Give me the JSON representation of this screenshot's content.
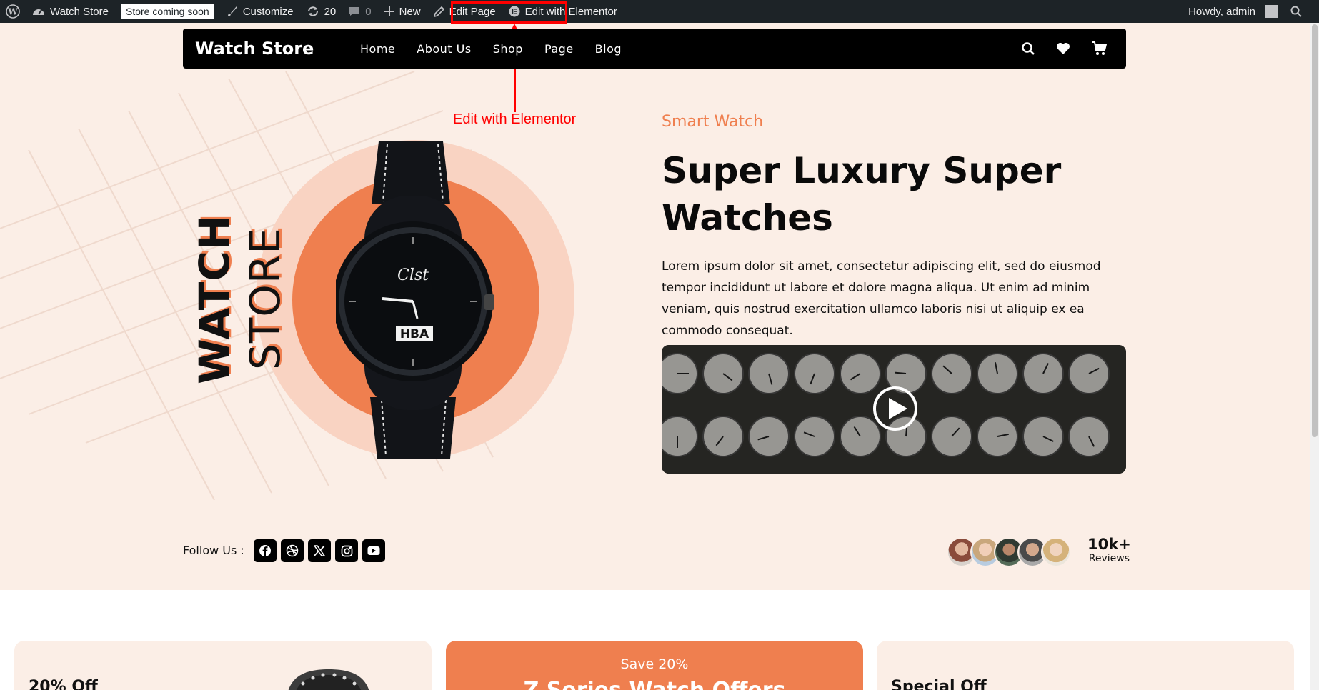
{
  "admin_bar": {
    "site_name": "Watch Store",
    "coming_soon_badge": "Store coming soon",
    "customize": "Customize",
    "updates_count": "20",
    "comments_count": "0",
    "new": "New",
    "edit_page": "Edit Page",
    "edit_elementor": "Edit with Elementor",
    "greeting": "Howdy, admin"
  },
  "annotation": {
    "label": "Edit with Elementor",
    "color": "#ff0000"
  },
  "nav": {
    "brand": "Watch Store",
    "items": [
      "Home",
      "About Us",
      "Shop",
      "Page",
      "Blog"
    ]
  },
  "hero": {
    "vertical_word_1": "WATCH",
    "vertical_word_2": "STORE",
    "watch_dial_brand": "Clst",
    "watch_dial_label": "HBA",
    "eyebrow": "Smart Watch",
    "title": "Super Luxury Super Watches",
    "description": "Lorem ipsum dolor sit amet, consectetur adipiscing elit, sed do eiusmod tempor incididunt ut labore et dolore magna aliqua. Ut enim ad minim veniam, quis nostrud exercitation ullamco laboris nisi ut aliquip ex ea commodo consequat."
  },
  "social": {
    "label": "Follow Us :",
    "icons": [
      "facebook-icon",
      "dribbble-icon",
      "x-icon",
      "instagram-icon",
      "youtube-icon"
    ]
  },
  "reviews": {
    "count": "10k+",
    "label": "Reviews"
  },
  "cards": {
    "card1_text": "20% Off",
    "card2_save": "Save 20%",
    "card2_title": "Z Series Watch Offers",
    "card3_text": "Special Off"
  },
  "colors": {
    "accent": "#ef7f4f",
    "background": "#fbeee6",
    "admin_bar": "#1d2327"
  }
}
